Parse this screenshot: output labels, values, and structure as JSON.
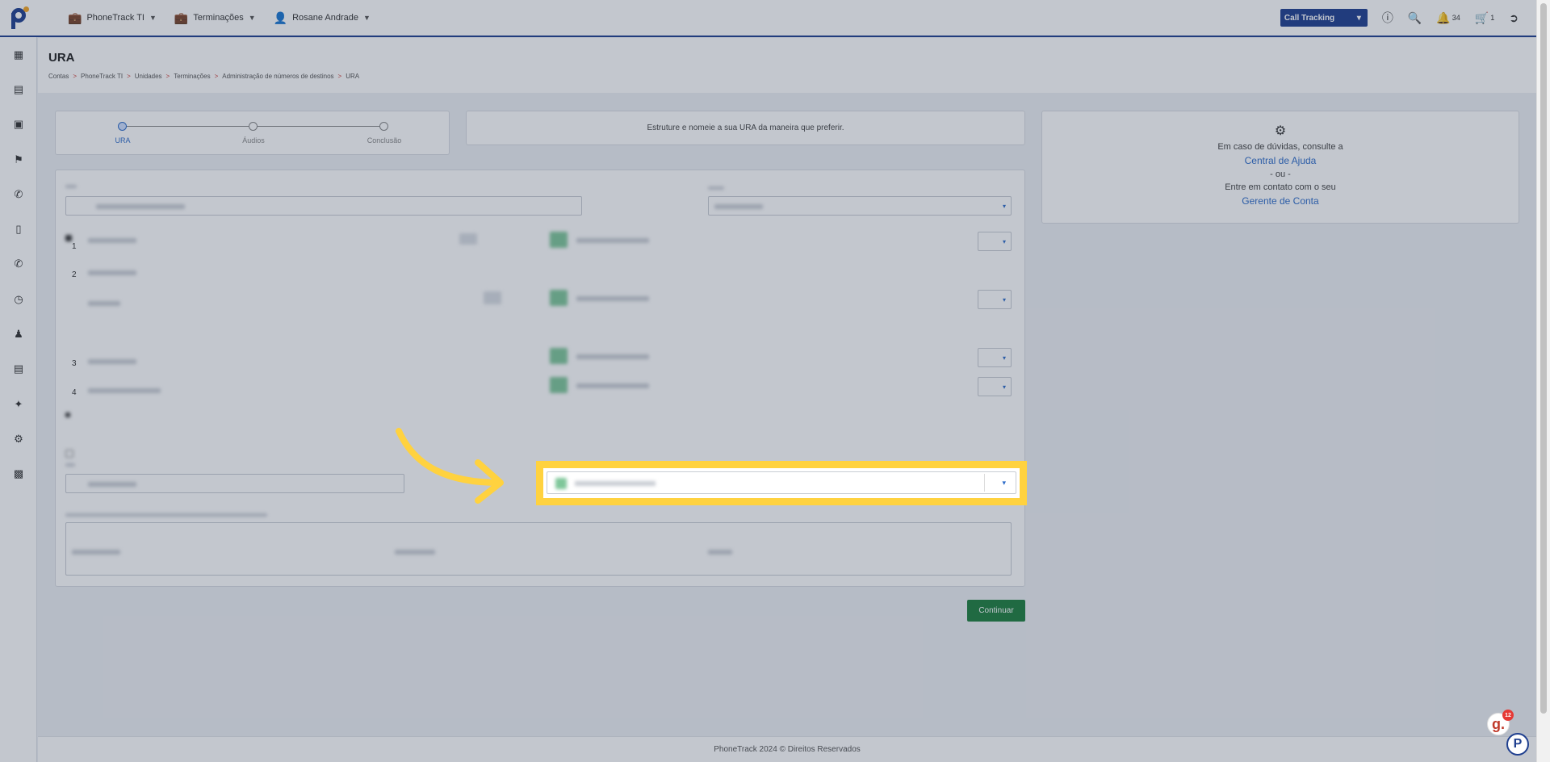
{
  "topbar": {
    "nav": [
      {
        "icon": "briefcase-icon",
        "label": "PhoneTrack TI"
      },
      {
        "icon": "briefcase-icon",
        "label": "Terminações"
      },
      {
        "icon": "user-icon",
        "label": "Rosane Andrade"
      }
    ],
    "call_tracking_label": "Call Tracking",
    "notifications_count": "34",
    "cart_count": "1"
  },
  "sidebar": {
    "items": [
      "dashboard-icon",
      "building-icon",
      "briefcase-icon",
      "flag-icon",
      "phone-icon",
      "contact-card-icon",
      "phone-icon",
      "history-icon",
      "users-icon",
      "books-icon",
      "puzzle-icon",
      "gear-icon",
      "store-icon"
    ]
  },
  "header": {
    "title": "URA",
    "breadcrumb": [
      "Contas",
      "PhoneTrack TI",
      "Unidades",
      "Terminações",
      "Administração de números de destinos",
      "URA"
    ],
    "separator": ">"
  },
  "stepper": {
    "steps": [
      "URA",
      "Áudios",
      "Conclusão"
    ],
    "active_index": 0
  },
  "info_text": "Estruture e nomeie a sua URA da maneira que preferir.",
  "help": {
    "line1": "Em caso de dúvidas, consulte a",
    "link1": "Central de Ajuda",
    "or": "- ou -",
    "line2": "Entre em contato com o seu",
    "link2": "Gerente de Conta"
  },
  "form": {
    "row_numbers": [
      "1",
      "2",
      "3",
      "4"
    ]
  },
  "continue_label": "Continuar",
  "footer_text": "PhoneTrack 2024 © Direitos Reservados",
  "widgets": {
    "g_badge_count": "12"
  },
  "colors": {
    "brand": "#1f3f8f",
    "highlight": "#ffd23f",
    "success": "#1e7e3e",
    "link": "#2e6cc9"
  }
}
